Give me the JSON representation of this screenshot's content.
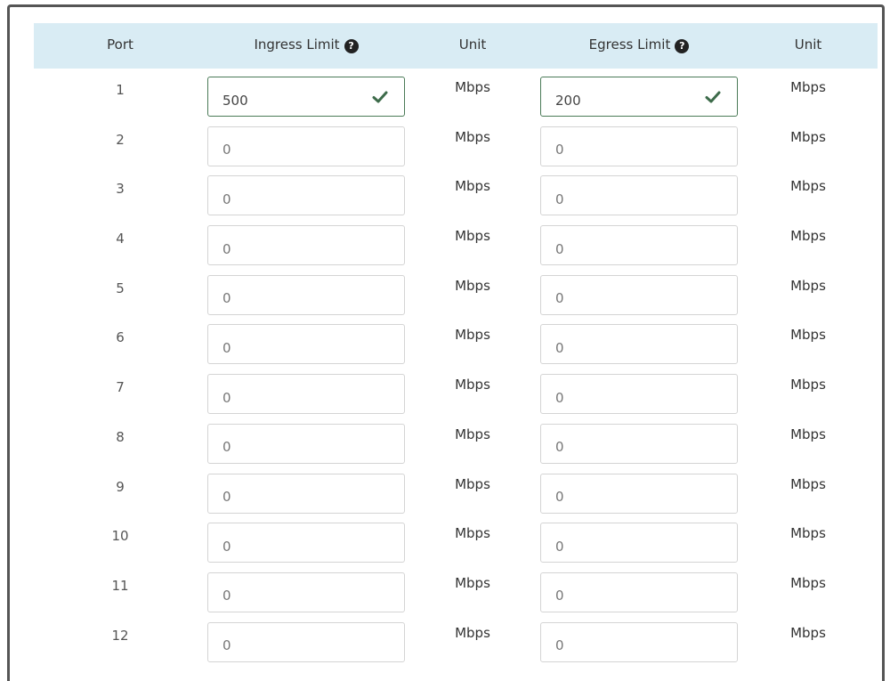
{
  "header": {
    "port": "Port",
    "ingress_limit": "Ingress Limit",
    "unit1": "Unit",
    "egress_limit": "Egress Limit",
    "unit2": "Unit"
  },
  "rows": [
    {
      "port": "1",
      "ingress": "500",
      "ingress_unit": "Mbps",
      "egress": "200",
      "egress_unit": "Mbps",
      "ingress_valid": true,
      "egress_valid": true
    },
    {
      "port": "2",
      "ingress": "0",
      "ingress_unit": "Mbps",
      "egress": "0",
      "egress_unit": "Mbps"
    },
    {
      "port": "3",
      "ingress": "0",
      "ingress_unit": "Mbps",
      "egress": "0",
      "egress_unit": "Mbps"
    },
    {
      "port": "4",
      "ingress": "0",
      "ingress_unit": "Mbps",
      "egress": "0",
      "egress_unit": "Mbps"
    },
    {
      "port": "5",
      "ingress": "0",
      "ingress_unit": "Mbps",
      "egress": "0",
      "egress_unit": "Mbps"
    },
    {
      "port": "6",
      "ingress": "0",
      "ingress_unit": "Mbps",
      "egress": "0",
      "egress_unit": "Mbps"
    },
    {
      "port": "7",
      "ingress": "0",
      "ingress_unit": "Mbps",
      "egress": "0",
      "egress_unit": "Mbps"
    },
    {
      "port": "8",
      "ingress": "0",
      "ingress_unit": "Mbps",
      "egress": "0",
      "egress_unit": "Mbps"
    },
    {
      "port": "9",
      "ingress": "0",
      "ingress_unit": "Mbps",
      "egress": "0",
      "egress_unit": "Mbps"
    },
    {
      "port": "10",
      "ingress": "0",
      "ingress_unit": "Mbps",
      "egress": "0",
      "egress_unit": "Mbps"
    },
    {
      "port": "11",
      "ingress": "0",
      "ingress_unit": "Mbps",
      "egress": "0",
      "egress_unit": "Mbps"
    },
    {
      "port": "12",
      "ingress": "0",
      "ingress_unit": "Mbps",
      "egress": "0",
      "egress_unit": "Mbps"
    }
  ],
  "icons": {
    "help": "question-circle-icon",
    "valid": "checkmark-icon"
  },
  "colors": {
    "header_bg": "#d9ecf4",
    "valid_border": "#4a7a57",
    "check": "#3d6b4a"
  }
}
